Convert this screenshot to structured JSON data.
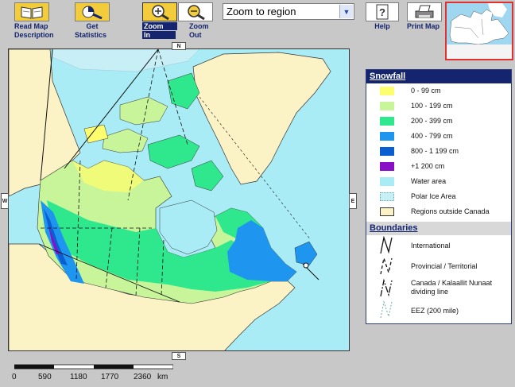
{
  "toolbar": {
    "read_map": {
      "label_line1": "Read Map",
      "label_line2": "Description",
      "icon": "book-icon"
    },
    "get_statistics": {
      "label_line1": "Get",
      "label_line2": "Statistics",
      "icon": "statistics-icon"
    },
    "zoom_in": {
      "label_line1": "Zoom",
      "label_line2": "In",
      "icon": "zoom-in-icon"
    },
    "zoom_out": {
      "label_line1": "Zoom",
      "label_line2": "Out",
      "icon": "zoom-out-icon"
    },
    "zoom_select": {
      "value": "Zoom to region"
    },
    "help": {
      "label": "Help",
      "icon": "help-icon"
    },
    "print_map": {
      "label": "Print Map",
      "icon": "printer-icon"
    }
  },
  "map": {
    "nav": {
      "north": "N",
      "south": "S",
      "east": "E",
      "west": "W"
    }
  },
  "legend": {
    "snowfall_title": "Snowfall",
    "snowfall_items": [
      {
        "label": "0 - 99 cm",
        "color": "#fdfd6e"
      },
      {
        "label": "100 - 199 cm",
        "color": "#c8f59a"
      },
      {
        "label": "200 - 399 cm",
        "color": "#2fe88e"
      },
      {
        "label": "400 - 799 cm",
        "color": "#1e96f0"
      },
      {
        "label": "800 - 1 199 cm",
        "color": "#0b5ed0"
      },
      {
        "label": "+1 200 cm",
        "color": "#8a10c8"
      },
      {
        "label": "Water area",
        "color": "#a9ecf6"
      },
      {
        "label": "Polar Ice Area",
        "color": "#c8eef6"
      },
      {
        "label": "Regions outside Canada",
        "color": "#fbf3c6"
      }
    ],
    "boundaries_title": "Boundaries",
    "boundary_items": [
      {
        "label": "International"
      },
      {
        "label": "Provincial / Territorial"
      },
      {
        "label_line1": "Canada / Kalaallit Nunaat",
        "label_line2": "dividing line"
      },
      {
        "label": "EEZ (200 mile)"
      }
    ]
  },
  "scale": {
    "ticks": [
      "0",
      "590",
      "1180",
      "1770",
      "2360"
    ],
    "unit": "km"
  }
}
